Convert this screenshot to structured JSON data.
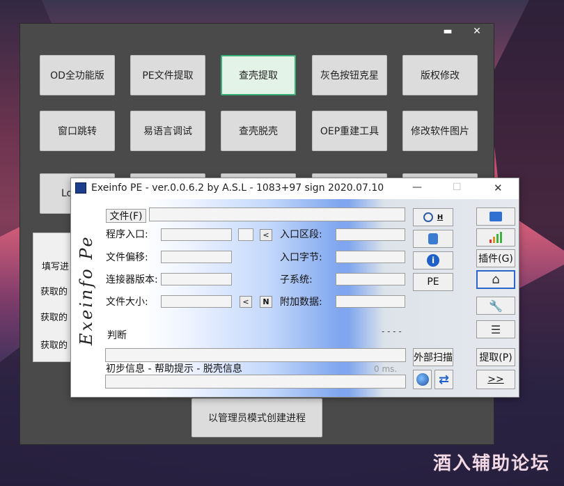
{
  "background_window": {
    "minimize_label": "▬",
    "close_label": "✕",
    "row1": [
      "OD全功能版",
      "PE文件提取",
      "查壳提取",
      "灰色按钮克星",
      "版权修改"
    ],
    "row2": [
      "窗口跳转",
      "易语言调试",
      "查壳脱壳",
      "OEP重建工具",
      "修改软件图片"
    ],
    "row3_partial": [
      "Lo"
    ],
    "panel_labels": [
      "填写进",
      "获取的",
      "获取的",
      "获取的"
    ],
    "admin_button": "以管理员模式创建进程"
  },
  "exeinfo": {
    "title": "Exeinfo PE - ver.0.0.6.2  by A.S.L -  1083+97 sign  2020.07.10",
    "min_label": "—",
    "max_label": "☐",
    "close_label": "✕",
    "side_logo": "Exeinfo Pe",
    "file_button": "文件(F)",
    "labels": {
      "entry_point": "程序入口:",
      "file_offset": "文件偏移:",
      "linker_version": "连接器版本:",
      "file_size": "文件大小:",
      "entry_section": "入口区段:",
      "entry_bytes": "入口字节:",
      "subsystem": "子系统:",
      "overlay": "附加数据:",
      "judge": "判断",
      "dashes": "- - - -",
      "info_line": "初步信息 - 帮助提示 - 脱壳信息",
      "ms": "0 ms."
    },
    "small_buttons": {
      "lt": "<",
      "n": "N",
      "h": "H"
    },
    "buttons": {
      "pe": "PE",
      "plugins": "插件(G)",
      "external_scan": "外部扫描",
      "extract": "提取(P)",
      "next": ">>"
    }
  },
  "watermark": "酒入辅助论坛",
  "colors": {
    "accent_green": "#3ab07a",
    "pe_blue": "#7fa6ee"
  }
}
